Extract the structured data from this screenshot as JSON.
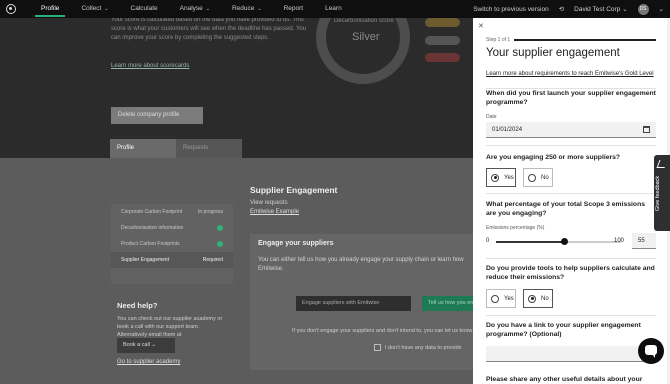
{
  "nav": {
    "items": [
      {
        "label": "Profile",
        "active": true,
        "dropdown": false
      },
      {
        "label": "Collect",
        "active": false,
        "dropdown": true
      },
      {
        "label": "Calculate",
        "active": false,
        "dropdown": false
      },
      {
        "label": "Analyse",
        "active": false,
        "dropdown": true
      },
      {
        "label": "Reduce",
        "active": false,
        "dropdown": true
      },
      {
        "label": "Report",
        "active": false,
        "dropdown": false
      },
      {
        "label": "Learn",
        "active": false,
        "dropdown": false
      }
    ],
    "switch_label": "Switch to previous version",
    "company": "David Test Corp",
    "avatar_initials": "DS"
  },
  "background": {
    "score_text": "Your score is calculated based on the data you have provided to us. This score is what your customers will see when the deadline has passed. You can improve your score by completing the suggested steps.",
    "scorecards_link": "Learn more about scorecards",
    "gauge_label": "Decarbonisation score",
    "gauge_value": "Silver",
    "delete_button": "Delete company profile",
    "tabs": [
      "Profile",
      "Requests"
    ],
    "progress_items": [
      {
        "label": "Corporate Carbon Footprint",
        "status": "In progress"
      },
      {
        "label": "Decarbonisation information",
        "status": ""
      },
      {
        "label": "Product Carbon Footprints",
        "status": ""
      },
      {
        "label": "Supplier Engagement",
        "status": "Required"
      }
    ],
    "help_title": "Need help?",
    "help_text": "You can check out our supplier academy or book a call with our support team. Alternatively email them at support@emitwise.com",
    "call_button": "Book a call",
    "academy_link": "Go to supplier academy",
    "se_title": "Supplier Engagement",
    "se_sub": "View requests",
    "se_link": "Emitwise Example",
    "engage_title": "Engage your suppliers",
    "engage_text": "You can either tell us how you already engage your supply chain or learn how Emitwise.",
    "engage_button": "Engage suppliers with Emitwise",
    "tell_button": "Tell us how you engage",
    "nodata_text": "If you don't engage your suppliers and don't intend to, you can let us know",
    "nodata_check": "I don't have any data to provide"
  },
  "panel": {
    "step": "Step 1 of 1",
    "title": "Your supplier engagement",
    "gold_link": "Learn more about requirements to reach Emitwise's Gold Level",
    "q1": "When did you first launch your supplier engagement programme?",
    "date_label": "Date",
    "date_value": "01/01/2024",
    "q2": "Are you engaging 250 or more suppliers?",
    "q2_answer": "Yes",
    "yes_label": "Yes",
    "no_label": "No",
    "q3": "What percentage of your total Scope 3 emissions are you engaging?",
    "emissions_label": "Emissions percentage (%)",
    "slider_min": "0",
    "slider_max": "100",
    "slider_value": "55",
    "slider_fraction": 0.55,
    "q4": "Do you provide tools to help suppliers calculate and reduce their emissions?",
    "q4_answer": "No",
    "q5": "Do you have a link to your supplier engagement programme? (Optional)",
    "q6": "Please share any other useful details about your"
  },
  "feedback": {
    "label": "Give feedback"
  },
  "colors": {
    "accent": "#2db37a",
    "nav_bg": "#0f0f10"
  }
}
